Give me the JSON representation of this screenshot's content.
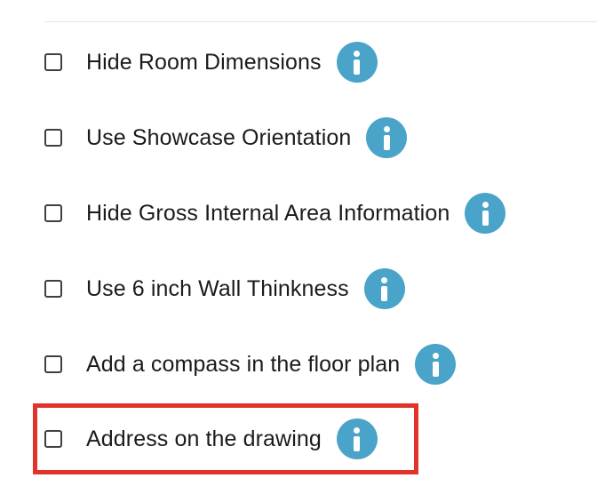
{
  "options": [
    {
      "label": "Hide Room Dimensions",
      "checked": false,
      "info_icon": "info-icon"
    },
    {
      "label": "Use Showcase Orientation",
      "checked": false,
      "info_icon": "info-icon"
    },
    {
      "label": "Hide Gross Internal Area Information",
      "checked": false,
      "info_icon": "info-icon"
    },
    {
      "label": "Use 6 inch Wall Thinkness",
      "checked": false,
      "info_icon": "info-icon"
    },
    {
      "label": "Add a compass in the floor plan",
      "checked": false,
      "info_icon": "info-icon"
    },
    {
      "label": "Address on the drawing",
      "checked": false,
      "info_icon": "info-icon",
      "highlighted": true
    }
  ],
  "colors": {
    "info_icon_bg": "#4aa3c8",
    "highlight_border": "#e0342a",
    "text": "#1b1b1b",
    "checkbox_border": "#3f3f3f"
  }
}
